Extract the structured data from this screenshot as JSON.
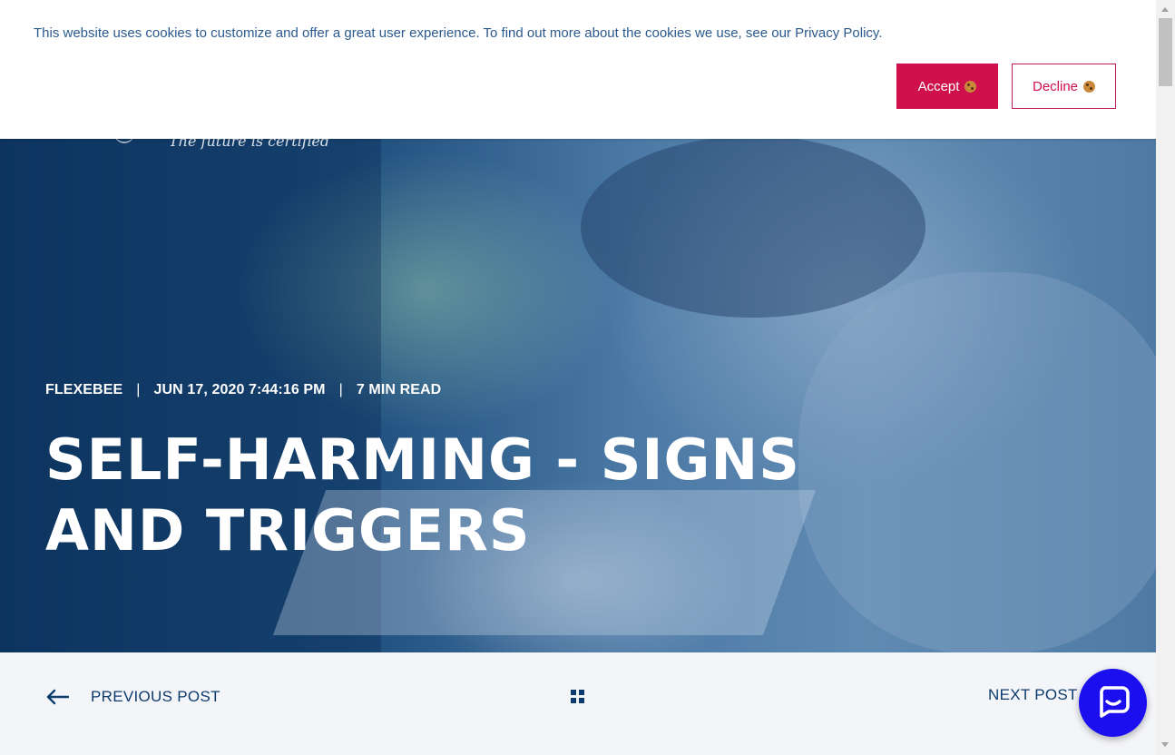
{
  "cookie_banner": {
    "message": "This website uses cookies to customize and offer a great user experience. To find out more about the cookies we use, see our Privacy Policy.",
    "accept_label": "Accept",
    "decline_label": "Decline",
    "accept_icon": "cookie-icon",
    "decline_icon": "cookie-icon",
    "accent_color": "#d0104c"
  },
  "logo": {
    "tagline": "The future is certified"
  },
  "article": {
    "author": "FLEXEBEE",
    "date": "JUN 17, 2020 7:44:16 PM",
    "read_time": "7 MIN READ",
    "separator": "|",
    "title": "SELF-HARMING - SIGNS AND TRIGGERS"
  },
  "post_nav": {
    "previous_label": "PREVIOUS POST",
    "next_label": "NEXT POST",
    "previous_icon": "arrow-left-icon",
    "all_posts_icon": "grid-icon"
  },
  "chat": {
    "icon": "chat-icon",
    "color": "#1b0ff0"
  }
}
